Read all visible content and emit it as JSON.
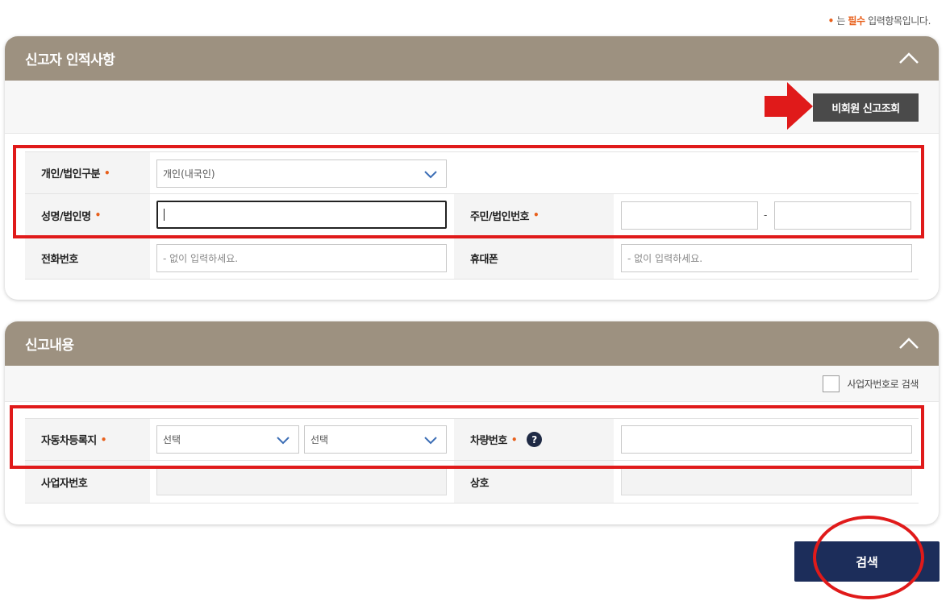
{
  "required_note": {
    "dot": "•",
    "prefix": "는",
    "word": "필수",
    "suffix": "입력항목입니다."
  },
  "section1": {
    "title": "신고자 인적사항",
    "lookup_button": "비회원 신고조회",
    "rows": {
      "person_type": {
        "label": "개인/법인구분",
        "value": "개인(내국인)"
      },
      "name": {
        "label": "성명/법인명",
        "value": ""
      },
      "id_number": {
        "label": "주민/법인번호",
        "separator": "-"
      },
      "phone": {
        "label": "전화번호",
        "placeholder": "- 없이 입력하세요."
      },
      "mobile": {
        "label": "휴대폰",
        "placeholder": "- 없이 입력하세요."
      }
    }
  },
  "section2": {
    "title": "신고내용",
    "checkbox_label": "사업자번호로 검색",
    "rows": {
      "car_registration": {
        "label": "자동차등록지",
        "select1": "선택",
        "select2": "선택"
      },
      "car_number": {
        "label": "차량번호",
        "help": "?"
      },
      "business_number": {
        "label": "사업자번호"
      },
      "company_name": {
        "label": "상호"
      }
    }
  },
  "search_button": "검색",
  "colors": {
    "header": "#9d9180",
    "required": "#e8601c",
    "annotation": "#e01a1a",
    "search_button": "#1c2d5a"
  }
}
